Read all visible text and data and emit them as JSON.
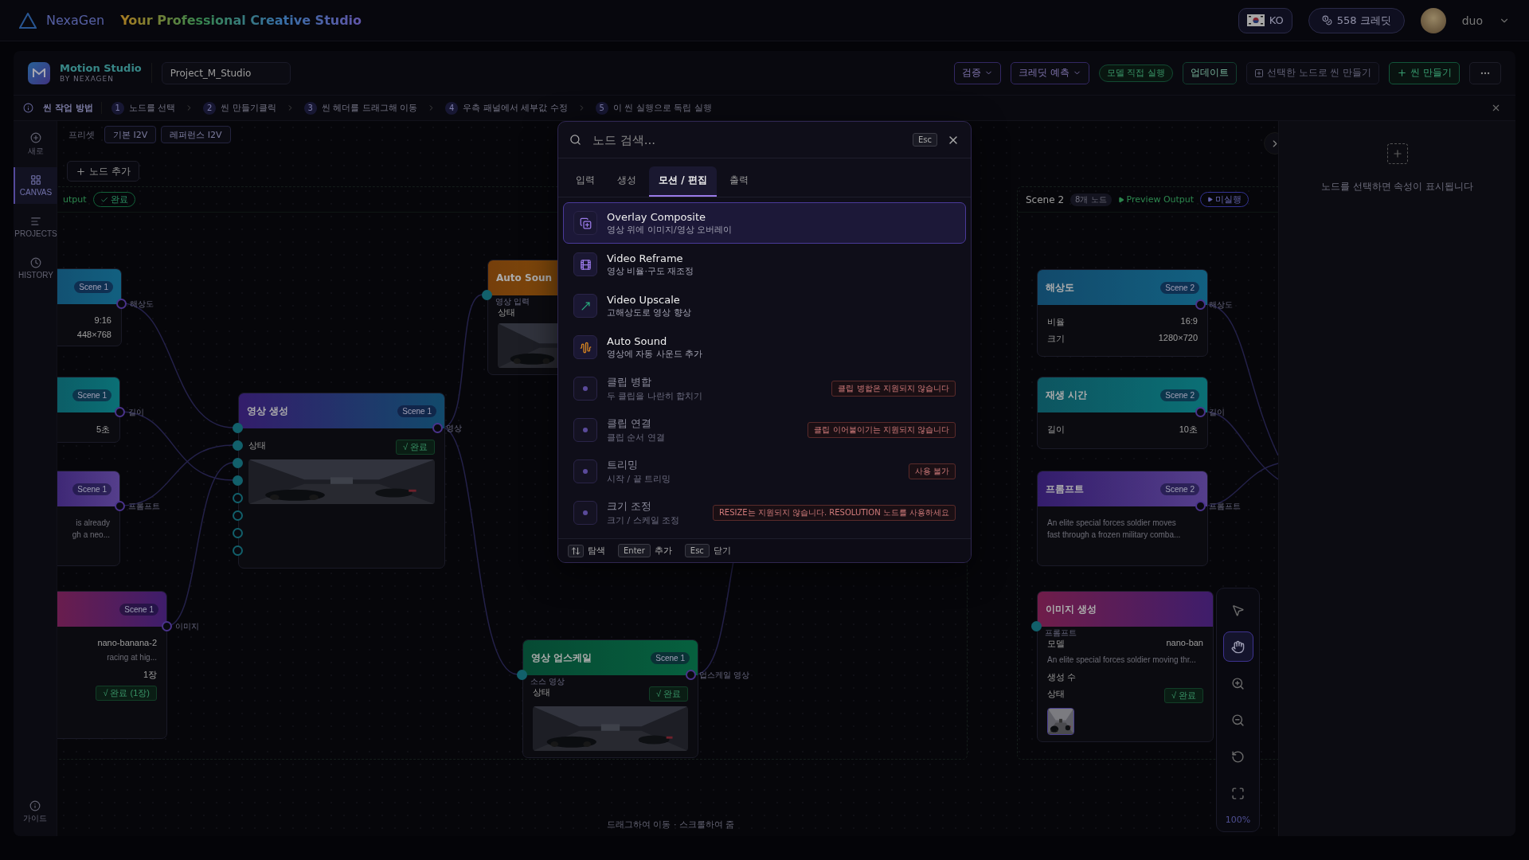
{
  "header": {
    "brand": "NexaGen",
    "tagline": "Your Professional Creative Studio",
    "language": "KO",
    "credits": "558 크레딧",
    "user": "duo"
  },
  "studio_bar": {
    "app_name": "Motion Studio",
    "app_sub": "BY NEXAGEN",
    "project": "Project_M_Studio",
    "actions": [
      {
        "kind": "dropdown",
        "label": "검증"
      },
      {
        "kind": "dropdown",
        "label": "크레딧 예측"
      },
      {
        "kind": "pill",
        "label": "모델 직접 실행"
      },
      {
        "kind": "button",
        "label": "업데이트"
      },
      {
        "kind": "disabled",
        "label": "선택한 노드로 씬 만들기"
      },
      {
        "kind": "primary",
        "label": "씬 만들기"
      },
      {
        "kind": "more"
      }
    ]
  },
  "guide": {
    "title": "씬 작업 방법",
    "steps": [
      {
        "number": "1",
        "text": "노드를 선택"
      },
      {
        "number": "2",
        "text": "씬 만들기클릭"
      },
      {
        "number": "3",
        "text": "씬 헤더를 드래그해 이동"
      },
      {
        "number": "4",
        "text": "우측 패널에서 세부값 수정"
      },
      {
        "number": "5",
        "text": "이 씬 실행으로 독립 실행"
      }
    ]
  },
  "sidebar": {
    "items": [
      {
        "kind": "new",
        "label": "새로",
        "selected": false
      },
      {
        "kind": "canvas",
        "label": "CANVAS",
        "selected": true
      },
      {
        "kind": "projects",
        "label": "PROJECTS",
        "selected": false
      },
      {
        "kind": "history",
        "label": "HISTORY",
        "selected": false
      }
    ],
    "footer": "가이드"
  },
  "canvas": {
    "preset_label": "프리셋",
    "presets": [
      "기본 I2V",
      "레퍼런스 I2V"
    ],
    "add_node": "노드 추가",
    "scenes": [
      {
        "preview": "utput",
        "status": "완료",
        "completed": true
      },
      {
        "name": "Scene 2",
        "count": "8개 노드",
        "preview": "Preview Output",
        "status": "미실행",
        "completed": false
      }
    ],
    "nodes": [
      {
        "kind": "resolution",
        "badge": "Scene 1",
        "output": "해상도",
        "body": [
          {
            "kind": "row",
            "value": "9:16"
          },
          {
            "kind": "row",
            "value": "448×768"
          }
        ]
      },
      {
        "kind": "duration",
        "badge": "Scene 1",
        "output": "길이",
        "body": [
          {
            "kind": "row",
            "value": "5초"
          }
        ]
      },
      {
        "kind": "prompt",
        "badge": "Scene 1",
        "output": "프롬프트",
        "body": [
          {
            "kind": "text",
            "lines": [
              "is already",
              "gh a neo..."
            ]
          }
        ]
      },
      {
        "badge": "Scene 1",
        "output": "이미지",
        "body": [
          {
            "kind": "row",
            "value": "nano-banana-2"
          },
          {
            "kind": "text",
            "lines": [
              "racing at hig..."
            ]
          },
          {
            "kind": "row",
            "value": "1장"
          },
          {
            "kind": "status",
            "value": "√ 완료 (1장)"
          }
        ]
      },
      {
        "kind": "video",
        "title": "영상 생성",
        "badge": "Scene 1",
        "output": "영상",
        "inputs": [
          {
            "connected": true
          },
          {
            "connected": true
          },
          {
            "connected": true
          },
          {
            "connected": true
          },
          {
            "connected": false
          },
          {
            "connected": false
          },
          {
            "connected": false
          },
          {
            "connected": false
          }
        ],
        "body": [
          {
            "kind": "status",
            "label": "상태",
            "value": "√ 완료"
          },
          {
            "kind": "thumb"
          }
        ]
      },
      {
        "kind": "sound",
        "title": "Auto Soun",
        "inputs": [
          {
            "label": "영상 입력",
            "connected": true
          }
        ],
        "body": [
          {
            "kind": "status",
            "label": "상태"
          },
          {
            "kind": "thumb"
          }
        ]
      },
      {
        "kind": "upscale",
        "title": "영상 업스케일",
        "badge": "Scene 1",
        "output": "업스케일 영상",
        "inputs": [
          {
            "label": "소스 영상",
            "connected": true
          }
        ],
        "body": [
          {
            "kind": "status",
            "label": "상태",
            "value": "√ 완료"
          },
          {
            "kind": "thumb"
          }
        ]
      },
      {
        "kind": "resolution",
        "title": "해상도",
        "badge": "Scene 2",
        "output": "해상도",
        "body": [
          {
            "kind": "row",
            "label": "비율",
            "value": "16:9"
          },
          {
            "kind": "row",
            "label": "크기",
            "value": "1280×720"
          }
        ]
      },
      {
        "kind": "duration",
        "title": "재생 시간",
        "badge": "Scene 2",
        "output": "길이",
        "body": [
          {
            "kind": "row",
            "label": "길이",
            "value": "10초"
          }
        ]
      },
      {
        "kind": "prompt",
        "title": "프롬프트",
        "badge": "Scene 2",
        "output": "프롬프트",
        "body": [
          {
            "kind": "text",
            "lines": [
              "An elite special forces soldier moves",
              "fast through a frozen military comba..."
            ]
          }
        ]
      },
      {
        "title": "이미지 생성",
        "inputs": [
          {
            "label": "프롬프트",
            "connected": true
          }
        ],
        "body": [
          {
            "kind": "row",
            "label": "모델",
            "value": "nano-ban"
          },
          {
            "kind": "text",
            "lines": [
              "An elite special forces soldier moving thr..."
            ]
          },
          {
            "kind": "row",
            "label": "생성 수"
          },
          {
            "kind": "status",
            "label": "상태",
            "value": "√ 완료"
          },
          {
            "kind": "small-thumb"
          }
        ]
      }
    ],
    "tools": [
      {
        "kind": "pointer",
        "selected": false
      },
      {
        "kind": "hand",
        "selected": true
      },
      {
        "kind": "zoom-in",
        "selected": false
      },
      {
        "kind": "zoom-out",
        "selected": false
      },
      {
        "kind": "reset",
        "selected": false
      },
      {
        "kind": "fit",
        "selected": false
      }
    ],
    "zoom": "100%",
    "hint": "드래그하여 이동 · 스크롤하여 줌"
  },
  "properties_panel": {
    "empty_text": "노드를 선택하면 속성이 표시됩니다"
  },
  "node_search": {
    "placeholder": "노드 검색...",
    "shortcut": "Esc",
    "tabs": [
      {
        "label": "입력",
        "selected": false
      },
      {
        "label": "생성",
        "selected": false
      },
      {
        "label": "모션 / 편집",
        "selected": true
      },
      {
        "label": "출력",
        "selected": false
      }
    ],
    "items": [
      {
        "kind": "overlay",
        "title": "Overlay Composite",
        "description": "영상 위에 이미지/영상 오버레이",
        "selected": true,
        "disabled": false
      },
      {
        "kind": "reframe",
        "title": "Video Reframe",
        "description": "영상 비율·구도 재조정",
        "selected": false,
        "disabled": false
      },
      {
        "kind": "upscale",
        "title": "Video Upscale",
        "description": "고해상도로 영상 향상",
        "selected": false,
        "disabled": false
      },
      {
        "kind": "sound",
        "title": "Auto Sound",
        "description": "영상에 자동 사운드 추가",
        "selected": false,
        "disabled": false
      },
      {
        "kind": "other",
        "title": "클립 병합",
        "description": "두 클립을 나란히 합치기",
        "selected": false,
        "disabled": true,
        "note": "클립 병합은 지원되지 않습니다"
      },
      {
        "kind": "other",
        "title": "클립 연결",
        "description": "클립 순서 연결",
        "selected": false,
        "disabled": true,
        "note": "클립 이어붙이기는 지원되지 않습니다"
      },
      {
        "kind": "other",
        "title": "트리밍",
        "description": "시작 / 끝 트리밍",
        "selected": false,
        "disabled": true,
        "note": "사용 불가"
      },
      {
        "kind": "other",
        "title": "크기 조정",
        "description": "크기 / 스케일 조정",
        "selected": false,
        "disabled": true,
        "note": "RESIZE는 지원되지 않습니다. RESOLUTION 노드를 사용하세요"
      }
    ],
    "footer": [
      {
        "kind": "arrows",
        "label": "탐색"
      },
      {
        "kind": "key",
        "key": "Enter",
        "label": "추가"
      },
      {
        "kind": "key",
        "key": "Esc",
        "label": "닫기"
      }
    ]
  }
}
